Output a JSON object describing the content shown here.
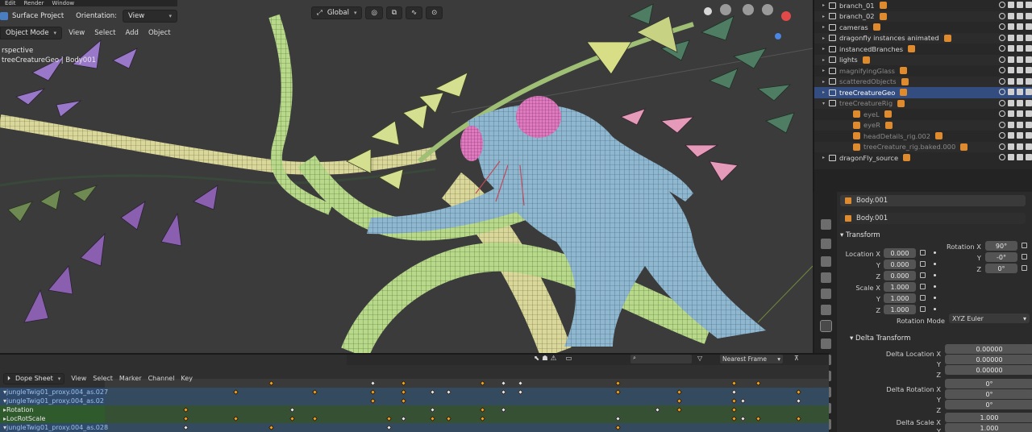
{
  "topbar": {
    "menus": [
      "Edit",
      "Render",
      "Window"
    ]
  },
  "viewport": {
    "header": {
      "surface_project_label": "Surface Project",
      "orientation_label": "Orientation:",
      "orientation_value": "View",
      "mode_value": "Object Mode",
      "menus": [
        "View",
        "Select",
        "Add",
        "Object"
      ],
      "transform_orientation": "Global"
    },
    "overlay_text": {
      "perspective": "rspective",
      "object_info": "treeCreatureGeo | Body001"
    },
    "colors": {
      "background": "#3b3b3b",
      "creature": "#8fb7cf",
      "eye": "#e07ac0",
      "branch_green": "#b8d98a",
      "leaf_purple": "#9a78c9",
      "leaf_pink": "#e27fb3",
      "leaf_teal": "#4e7d63",
      "leaf_yellow": "#d9e28f"
    }
  },
  "outliner": {
    "rows": [
      {
        "name": "branch_01",
        "tri": "▸",
        "state": "normal"
      },
      {
        "name": "branch_02",
        "tri": "▸",
        "state": "normal"
      },
      {
        "name": "cameras",
        "tri": "▸",
        "state": "normal"
      },
      {
        "name": "dragonfly instances animated",
        "tri": "▸",
        "state": "normal"
      },
      {
        "name": "instancedBranches",
        "tri": "▸",
        "state": "normal"
      },
      {
        "name": "lights",
        "tri": "▸",
        "state": "normal"
      },
      {
        "name": "magnifyingGlass",
        "tri": "▸",
        "state": "dim"
      },
      {
        "name": "scatteredObjects",
        "tri": "▸",
        "state": "dim"
      },
      {
        "name": "treeCreatureGeo",
        "tri": "▸",
        "state": "selected"
      },
      {
        "name": "treeCreatureRig",
        "tri": "▾",
        "state": "dim"
      },
      {
        "name": "eyeL",
        "tri": "",
        "state": "dim"
      },
      {
        "name": "eyeR",
        "tri": "",
        "state": "dim"
      },
      {
        "name": "headDetails_rig.002",
        "tri": "",
        "state": "dim"
      },
      {
        "name": "treeCreature_rig.baked.000",
        "tri": "",
        "state": "dim"
      },
      {
        "name": "dragonFly_source",
        "tri": "▸",
        "state": "normal"
      }
    ]
  },
  "properties": {
    "object_name": "Body.001",
    "data_name": "Body.001",
    "transform": {
      "title": "Transform",
      "location_label": "Location X",
      "location": [
        "0.000",
        "0.000",
        "0.000"
      ],
      "rotation_label": "Rotation X",
      "rotation": [
        "90°",
        "-0°",
        "0°"
      ],
      "scale_label": "Scale X",
      "scale": [
        "1.000",
        "1.000",
        "1.000"
      ],
      "y_label": "Y",
      "z_label": "Z",
      "rotation_mode_label": "Rotation Mode",
      "rotation_mode_value": "XYZ Euler"
    },
    "delta": {
      "title": "Delta Transform",
      "location_label": "Delta Location X",
      "location": [
        "0.00000",
        "0.00000",
        "0.00000"
      ],
      "rotation_label": "Delta Rotation X",
      "rotation": [
        "0°",
        "0°",
        "0°"
      ],
      "scale_label": "Delta Scale X",
      "scale": [
        "1.000",
        "1.000"
      ],
      "y_label": "Y",
      "z_label": "Z"
    }
  },
  "dopesheet": {
    "editor_label": "Dope Sheet",
    "menus": [
      "View",
      "Select",
      "Marker",
      "Channel",
      "Key"
    ],
    "snap_value": "Nearest Frame",
    "channels": [
      {
        "name": "jungleTwig01_proxy.004_as.027",
        "kind": "object"
      },
      {
        "name": "jungleTwig01_proxy.004_as.02",
        "kind": "object"
      },
      {
        "name": "Rotation",
        "kind": "group"
      },
      {
        "name": "LocRotScale",
        "kind": "group"
      },
      {
        "name": "jungleTwig01_proxy.004_as.028",
        "kind": "object"
      }
    ]
  }
}
